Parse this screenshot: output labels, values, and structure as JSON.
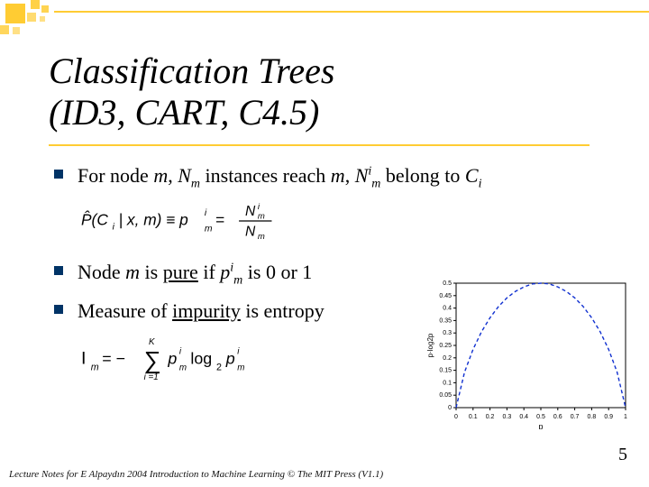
{
  "title_line1": "Classification Trees",
  "title_line2": "(ID3, CART, C4.5)",
  "bullets": {
    "b1_pre": "For node ",
    "b1_m": "m",
    "b1_mid1": ", ",
    "b1_Nm": "N",
    "b1_Nm_sub": "m",
    "b1_mid2": " instances reach ",
    "b1_m2": "m",
    "b1_mid3": ", ",
    "b1_Ni": "N",
    "b1_Ni_sup": "i",
    "b1_Ni_sub": "m",
    "b1_mid4": " belong to ",
    "b1_Ci": "C",
    "b1_Ci_sub": "i",
    "b2_pre": "Node ",
    "b2_m": "m",
    "b2_mid1": " is ",
    "b2_pure": "pure",
    "b2_mid2": " if ",
    "b2_p": "p",
    "b2_p_sup": "i",
    "b2_p_sub": "m",
    "b2_tail": " is 0 or 1",
    "b3_pre": "Measure of ",
    "b3_imp": "impurity",
    "b3_tail": " is entropy"
  },
  "formula1": {
    "lhs1": "P̂(C",
    "lhs1_sub": "i",
    "lhs2": " | x, m) ≡ p",
    "lhs2_sup": "i",
    "lhs2_sub": "m",
    "eq": " = ",
    "num": "N",
    "num_sup": "i",
    "num_sub": "m",
    "den": "N",
    "den_sub": "m"
  },
  "formula2": {
    "I": "I",
    "I_sub": "m",
    "eq": " = −",
    "sum_top": "K",
    "sum_bot": "i =1",
    "p1": "p",
    "p1_sup": "i",
    "p1_sub": "m",
    "log": "log",
    "log_sub": "2",
    "p2": "p",
    "p2_sup": "i",
    "p2_sub": "m"
  },
  "chart_data": {
    "type": "line",
    "xlabel": "p",
    "ylabel": "p·log2p",
    "x_ticks": [
      "0",
      "0.1",
      "0.2",
      "0.3",
      "0.4",
      "0.5",
      "0.6",
      "0.7",
      "0.8",
      "0.9",
      "1"
    ],
    "y_ticks": [
      "0",
      "0.05",
      "0.1",
      "0.15",
      "0.2",
      "0.25",
      "0.3",
      "0.35",
      "0.4",
      "0.45",
      "0.5"
    ],
    "xlim": [
      0,
      1
    ],
    "ylim": [
      0,
      0.5
    ],
    "x": [
      0.0,
      0.05,
      0.1,
      0.15,
      0.2,
      0.25,
      0.3,
      0.35,
      0.4,
      0.45,
      0.5,
      0.55,
      0.6,
      0.65,
      0.7,
      0.75,
      0.8,
      0.85,
      0.9,
      0.95,
      1.0
    ],
    "values": [
      0.0,
      0.143,
      0.234,
      0.305,
      0.361,
      0.406,
      0.441,
      0.467,
      0.485,
      0.497,
      0.5,
      0.497,
      0.485,
      0.467,
      0.441,
      0.406,
      0.361,
      0.305,
      0.234,
      0.143,
      0.0
    ]
  },
  "footer": "Lecture Notes for E Alpaydın 2004 Introduction to Machine Learning © The MIT Press (V1.1)",
  "page_number": "5"
}
